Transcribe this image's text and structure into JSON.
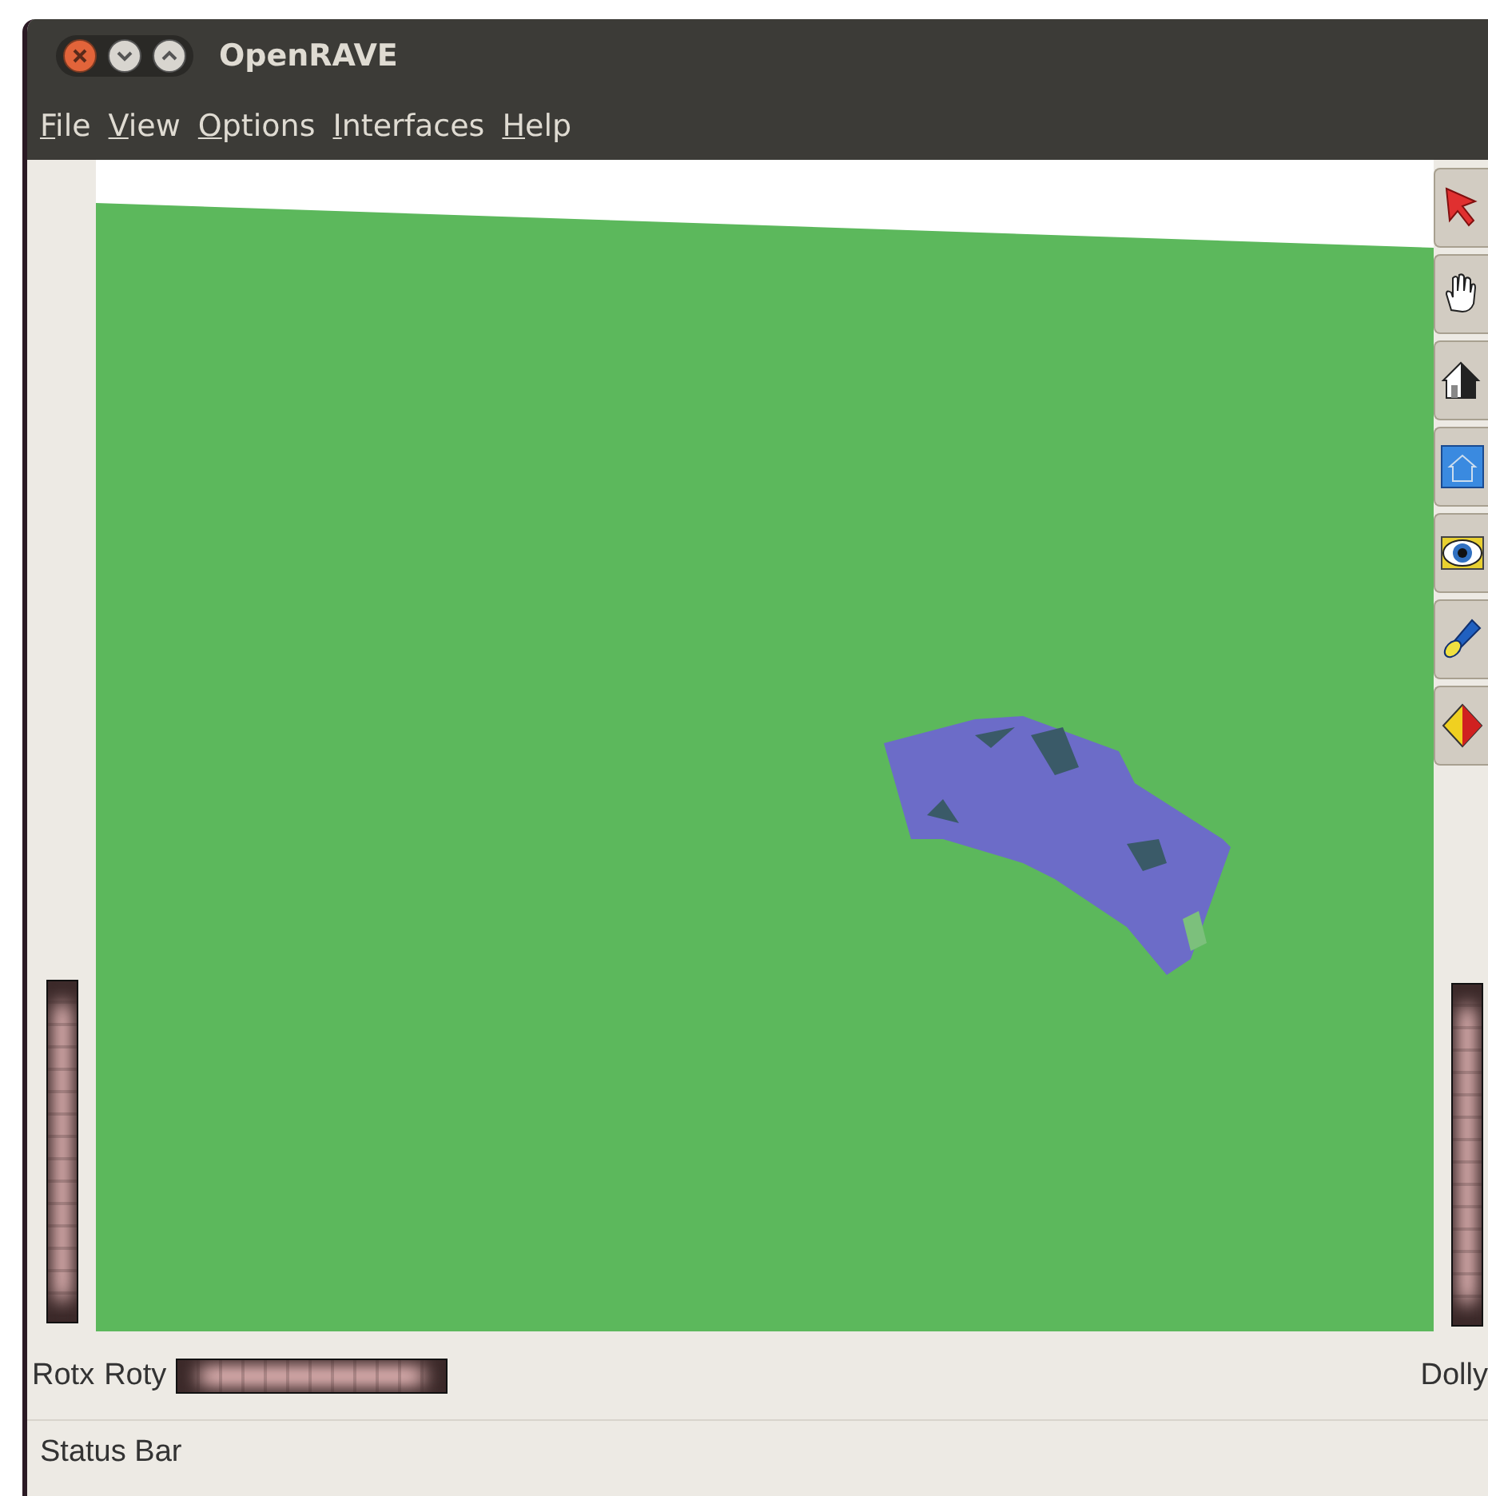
{
  "window": {
    "title": "OpenRAVE"
  },
  "menu": [
    {
      "label": "File"
    },
    {
      "label": "View"
    },
    {
      "label": "Options"
    },
    {
      "label": "Interfaces"
    },
    {
      "label": "Help"
    }
  ],
  "toolbar": [
    {
      "kind": "pointer"
    },
    {
      "kind": "hand"
    },
    {
      "kind": "home"
    },
    {
      "kind": "set-home"
    },
    {
      "kind": "view-all"
    },
    {
      "kind": "seek"
    },
    {
      "kind": "projection"
    }
  ],
  "controls": {
    "rotx": "Rotx",
    "roty": "Roty",
    "dolly": "Dolly"
  },
  "status_bar": "Status Bar"
}
